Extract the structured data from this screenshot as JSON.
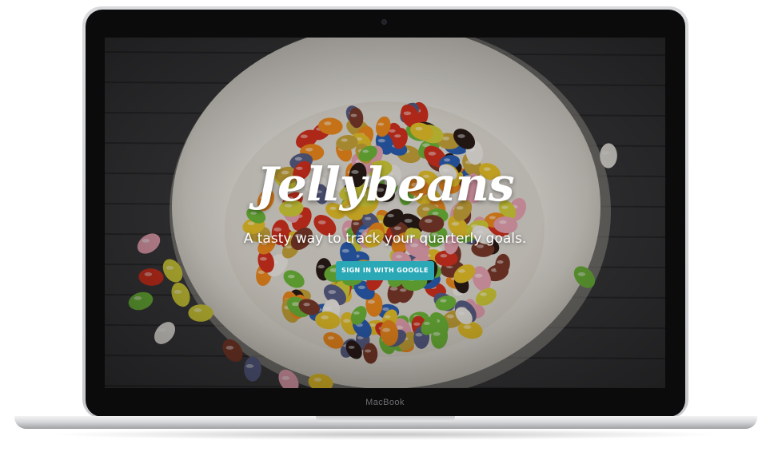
{
  "device": {
    "brand_label": "MacBook"
  },
  "hero": {
    "title": "Jellybeans",
    "tagline": "A tasty way to track your quarterly goals.",
    "signin_label": "SIGN IN WITH GOOGLE"
  },
  "colors": {
    "button": "#2aa8b6",
    "text": "#ffffff",
    "table_wood": "#3a3a3c",
    "bowl": "#ece9e2"
  },
  "photo": {
    "subject": "white bowl of colorful jelly beans on a dark wooden table",
    "bean_colors": [
      "#e8c22a",
      "#d4311e",
      "#f08a1e",
      "#6fb93a",
      "#efece6",
      "#7a3a2a",
      "#2b5fb3",
      "#5a5f86",
      "#c8a53a",
      "#2a1c18",
      "#e8a3b3",
      "#d5d03a"
    ]
  }
}
